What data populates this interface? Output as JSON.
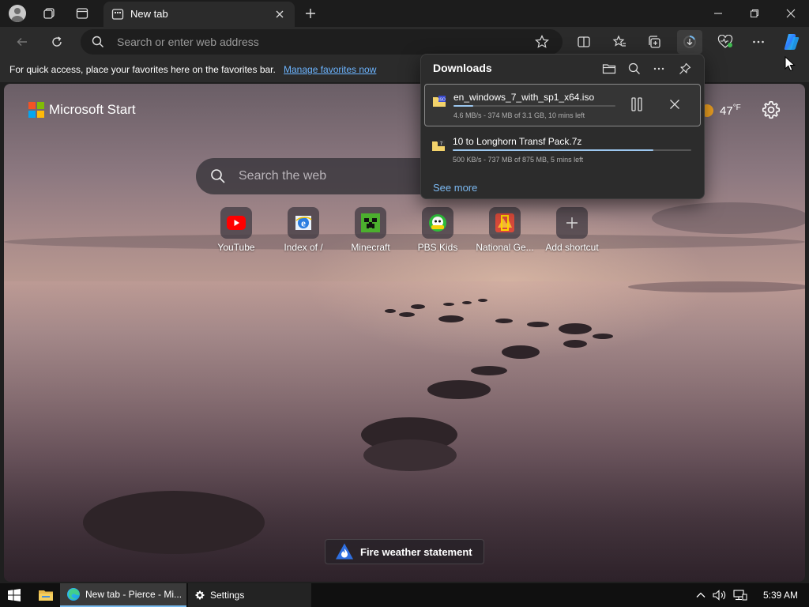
{
  "browser": {
    "tab_title": "New tab",
    "address_placeholder": "Search or enter web address",
    "favorites_hint": "For quick access, place your favorites here on the favorites bar.",
    "favorites_link": "Manage favorites now"
  },
  "newtab": {
    "brand": "Microsoft Start",
    "weather_temp": "47",
    "weather_unit": "°F",
    "search_placeholder": "Search the web",
    "shortcuts": [
      {
        "label": "YouTube"
      },
      {
        "label": "Index of /"
      },
      {
        "label": "Minecraft"
      },
      {
        "label": "PBS Kids"
      },
      {
        "label": "National Ge..."
      },
      {
        "label": "Add shortcut"
      }
    ],
    "alert": "Fire weather statement"
  },
  "downloads": {
    "title": "Downloads",
    "items": [
      {
        "name": "en_windows_7_with_sp1_x64.iso",
        "status": "4.6 MB/s - 374 MB of 3.1 GB, 10 mins left",
        "progress": 0.12
      },
      {
        "name": "10 to Longhorn Transf Pack.7z",
        "status": "500 KB/s - 737 MB of 875 MB, 5 mins left",
        "progress": 0.84
      }
    ],
    "see_more": "See more"
  },
  "taskbar": {
    "edge_task": "New tab - Pierce - Mi...",
    "settings_task": "Settings",
    "time": "5:39 AM"
  },
  "colors": {
    "accent": "#76b9ed",
    "link": "#6cb4ff",
    "progress": "#9cc7ef"
  }
}
